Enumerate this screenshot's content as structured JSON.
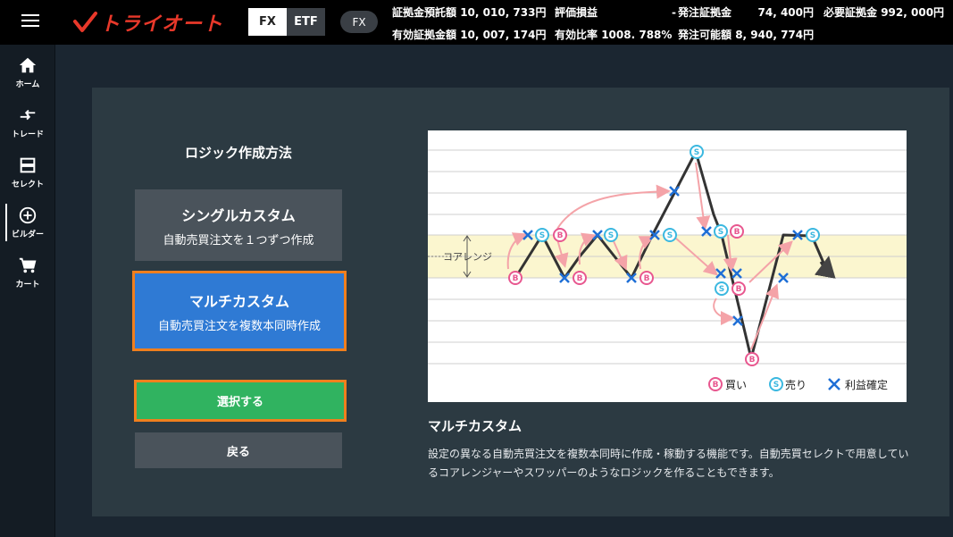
{
  "brand": {
    "name": "トライオート",
    "color": "#e8382a"
  },
  "header": {
    "segment": [
      "FX",
      "ETF"
    ],
    "product_pill": "FX",
    "stats": [
      {
        "label": "証拠金預託額",
        "value": "10, 010, 733円"
      },
      {
        "label": "評価損益",
        "value": "-"
      },
      {
        "label": "発注証拠金",
        "value": "74, 400円"
      },
      {
        "label": "必要証拠金",
        "value": "992, 000円"
      },
      {
        "label": "有効証拠金額",
        "value": "10, 007, 174円"
      },
      {
        "label": "有効比率",
        "value": "1008. 788%"
      },
      {
        "label": "発注可能額",
        "value": "8, 940, 774円"
      }
    ]
  },
  "sidebar": {
    "items": [
      {
        "label": "ホーム",
        "icon": "home-icon"
      },
      {
        "label": "トレード",
        "icon": "trade-arrows-icon"
      },
      {
        "label": "セレクト",
        "icon": "select-icon"
      },
      {
        "label": "ビルダー",
        "icon": "add-circle-icon",
        "active": true
      },
      {
        "label": "カート",
        "icon": "cart-icon"
      }
    ]
  },
  "main": {
    "title": "ロジック作成方法",
    "options": [
      {
        "title": "シングルカスタム",
        "desc": "自動売買注文を１つずつ作成"
      },
      {
        "title": "マルチカスタム",
        "desc": "自動売買注文を複数本同時作成",
        "selected": true
      }
    ],
    "select_button": "選択する",
    "back_button": "戻る",
    "description_title": "マルチカスタム",
    "description_text": "設定の異なる自動売買注文を複数本同時に作成・稼動する機能です。自動売買セレクトで用意しているコアレンジャーやスワッパーのようなロジックを作ることもできます。"
  },
  "diagram": {
    "core_range_label": "コアレンジ",
    "legend": [
      {
        "marker": "B",
        "label": "買い",
        "color": "#e8578f"
      },
      {
        "marker": "S",
        "label": "売り",
        "color": "#3bb8e0"
      },
      {
        "marker": "x",
        "label": "利益確定",
        "color": "#1f6fd6"
      }
    ]
  },
  "colors": {
    "accent_orange": "#f07f1d",
    "select_green": "#30b360",
    "selected_blue": "#2f7ad4",
    "panel": "#2c3a42"
  }
}
